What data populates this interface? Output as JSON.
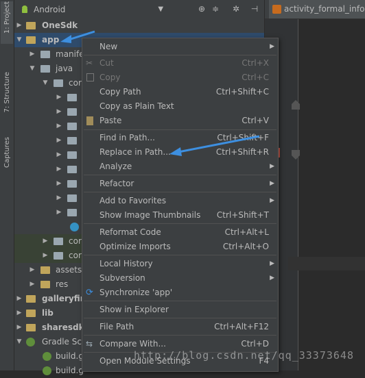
{
  "toolstrip": {
    "project_tab": "1: Project",
    "structure_tab": "7: Structure",
    "captures_tab": "Captures"
  },
  "panel": {
    "view_selector": "Android",
    "dropdown_glyph": "▼"
  },
  "editor": {
    "tab_label": "activity_formal_info.x"
  },
  "tree": [
    {
      "label": "OneSdk"
    },
    {
      "label": "app"
    },
    {
      "label": "manife"
    },
    {
      "label": "java"
    },
    {
      "label": "cor"
    },
    {
      "label": "cor"
    },
    {
      "label": "cor"
    },
    {
      "label": "assets"
    },
    {
      "label": "res"
    },
    {
      "label": "galleryfin"
    },
    {
      "label": "lib"
    },
    {
      "label": "sharesdk"
    },
    {
      "label": "Gradle Sc"
    },
    {
      "label": "build.g"
    },
    {
      "label": "build.g"
    }
  ],
  "menu": {
    "new": {
      "label": "New"
    },
    "cut": {
      "label": "Cut",
      "shortcut": "Ctrl+X"
    },
    "copy": {
      "label": "Copy",
      "shortcut": "Ctrl+C"
    },
    "copy_path": {
      "label": "Copy Path",
      "shortcut": "Ctrl+Shift+C"
    },
    "copy_plain": {
      "label": "Copy as Plain Text"
    },
    "paste": {
      "label": "Paste",
      "shortcut": "Ctrl+V"
    },
    "find_in_path": {
      "label": "Find in Path...",
      "shortcut": "Ctrl+Shift+F"
    },
    "replace_in_path": {
      "label": "Replace in Path...",
      "shortcut": "Ctrl+Shift+R"
    },
    "analyze": {
      "label": "Analyze"
    },
    "refactor": {
      "label": "Refactor"
    },
    "add_favorites": {
      "label": "Add to Favorites"
    },
    "show_thumbnails": {
      "label": "Show Image Thumbnails",
      "shortcut": "Ctrl+Shift+T"
    },
    "reformat": {
      "label": "Reformat Code",
      "shortcut": "Ctrl+Alt+L"
    },
    "optimize": {
      "label": "Optimize Imports",
      "shortcut": "Ctrl+Alt+O"
    },
    "local_history": {
      "label": "Local History"
    },
    "subversion": {
      "label": "Subversion"
    },
    "synchronize": {
      "label": "Synchronize 'app'"
    },
    "show_explorer": {
      "label": "Show in Explorer"
    },
    "file_path": {
      "label": "File Path",
      "shortcut": "Ctrl+Alt+F12"
    },
    "compare": {
      "label": "Compare With...",
      "shortcut": "Ctrl+D"
    },
    "module_settings": {
      "label": "Open Module Settings",
      "shortcut": "F4"
    },
    "submenu_glyph": "▶"
  },
  "watermark": "http://blog.csdn.net/qq_33373648",
  "colors": {
    "selection": "#2f4b6b",
    "annotation_arrow": "#3d8fe0",
    "panel_bg": "#3c3f41",
    "editor_bg": "#2b2b2b"
  }
}
